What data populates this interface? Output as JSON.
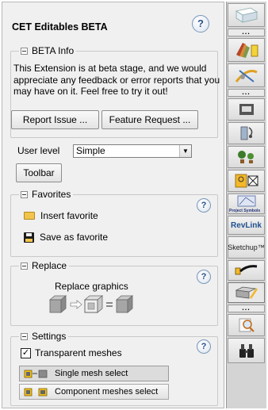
{
  "panel": {
    "title": "CET Editables BETA",
    "help_symbol": "?"
  },
  "beta_info": {
    "label": "BETA Info",
    "text": "This Extension is at beta stage, and we would appreciate any feedback or error reports that you may have on it. Feel free to try it out!",
    "report_label": "Report Issue ...",
    "feature_label": "Feature Request ..."
  },
  "user_level": {
    "label": "User level",
    "value": "Simple"
  },
  "toolbar_label": "Toolbar",
  "favorites": {
    "label": "Favorites",
    "insert_label": "Insert favorite",
    "save_label": "Save as favorite"
  },
  "replace": {
    "label": "Replace",
    "graphics_label": "Replace graphics"
  },
  "settings": {
    "label": "Settings",
    "transparent_label": "Transparent meshes",
    "transparent_checked": true,
    "single_label": "Single mesh select",
    "component_label": "Component meshes select"
  },
  "side_tabs": {
    "more_symbol": "...",
    "revlink_label": "RevLink",
    "sketchup_label": "Sketchup™",
    "project_label": "Project Symbols"
  },
  "colors": {
    "panel_bg": "#f0f0f0",
    "help_blue": "#2a4f8a",
    "revlink_blue": "#1f4f8f"
  }
}
